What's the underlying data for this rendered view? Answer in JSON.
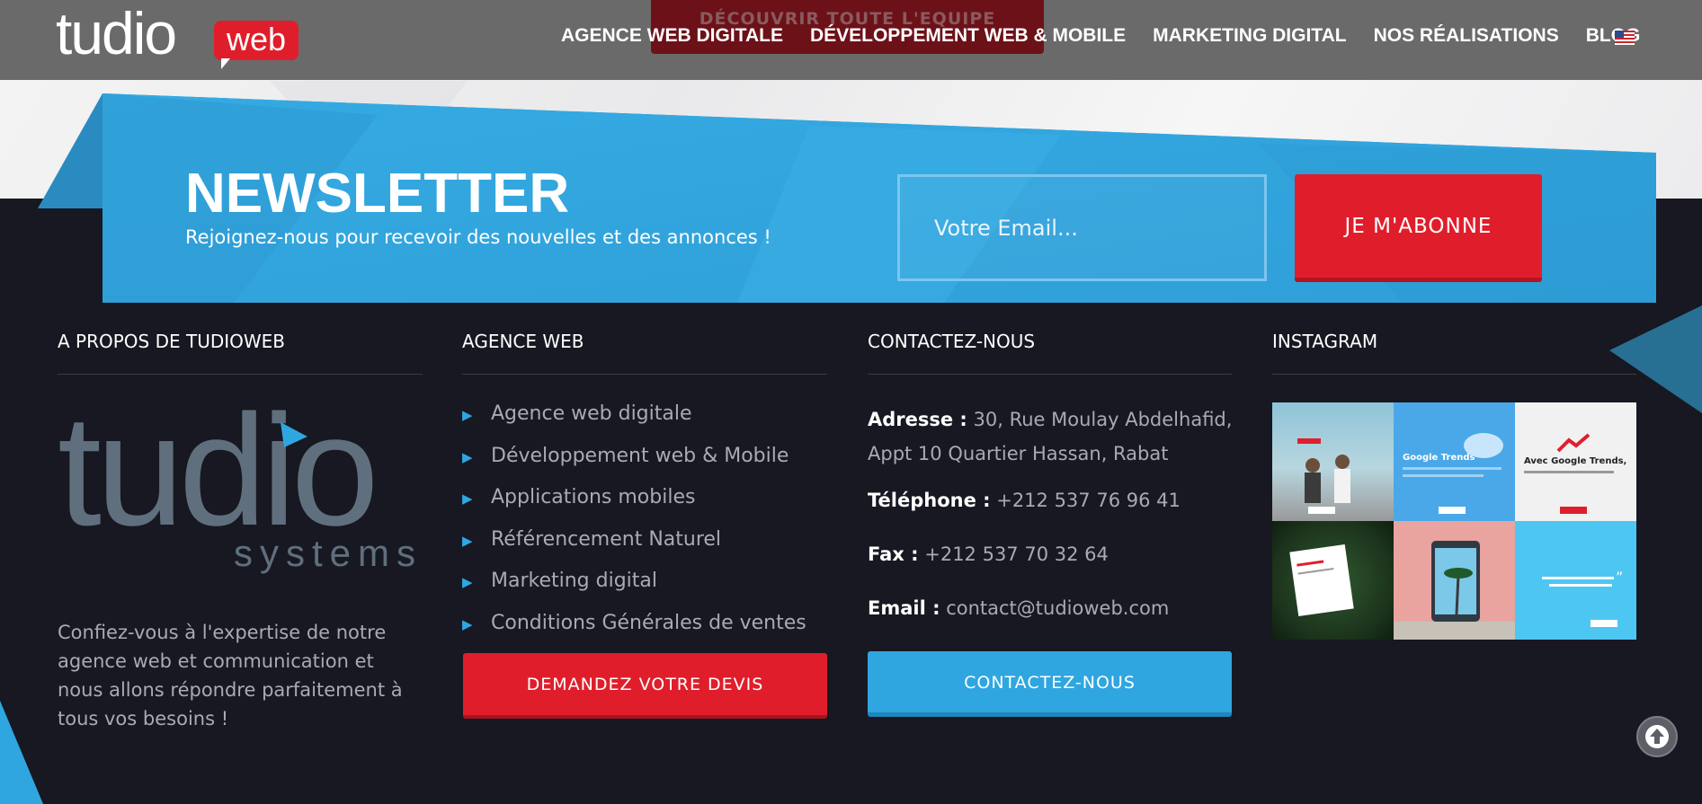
{
  "header": {
    "ghost_button": "DÉCOUVRIR TOUTE L'EQUIPE",
    "logo_text": "tudio",
    "logo_badge": "web",
    "nav": [
      "AGENCE WEB DIGITALE",
      "DÉVELOPPEMENT WEB & MOBILE",
      "MARKETING DIGITAL",
      "NOS RÉALISATIONS",
      "BLOG"
    ],
    "flag_icon": "us-flag-icon"
  },
  "newsletter": {
    "title": "NEWSLETTER",
    "subtitle": "Rejoignez-nous pour recevoir des nouvelles et des annonces !",
    "email_placeholder": "Votre Email...",
    "submit_label": "JE M'ABONNE"
  },
  "footer": {
    "about": {
      "title": "A PROPOS DE TUDIOWEB",
      "logo_word": "tudio",
      "logo_sub": "systems",
      "text": "Confiez-vous à l'expertise de notre agence web et communication et nous allons répondre parfaitement à tous vos besoins !"
    },
    "agency": {
      "title": "AGENCE WEB",
      "items": [
        "Agence web digitale",
        "Développement web & Mobile",
        "Applications mobiles",
        "Référencement Naturel",
        "Marketing digital",
        "Conditions Générales de ventes"
      ],
      "cta": "DEMANDEZ VOTRE DEVIS"
    },
    "contact": {
      "title": "CONTACTEZ-NOUS",
      "address_label": "Adresse :",
      "address": "30, Rue Moulay Abdelhafid, Appt 10 Quartier Hassan, Rabat",
      "phone_label": "Téléphone :",
      "phone": "+212 537 76 96 41",
      "fax_label": "Fax :",
      "fax": "+212 537 70 32 64",
      "email_label": "Email :",
      "email": "contact@tudioweb.com",
      "cta": "CONTACTEZ-NOUS"
    },
    "instagram": {
      "title": "INSTAGRAM",
      "tiles": [
        {
          "caption": ""
        },
        {
          "caption": "Google Trends"
        },
        {
          "caption": "Avec Google Trends,"
        },
        {
          "caption": ""
        },
        {
          "caption": ""
        },
        {
          "caption": ""
        }
      ]
    }
  },
  "colors": {
    "accent_blue": "#2fa6e0",
    "accent_red": "#e01e2b",
    "footer_bg": "#171821"
  }
}
